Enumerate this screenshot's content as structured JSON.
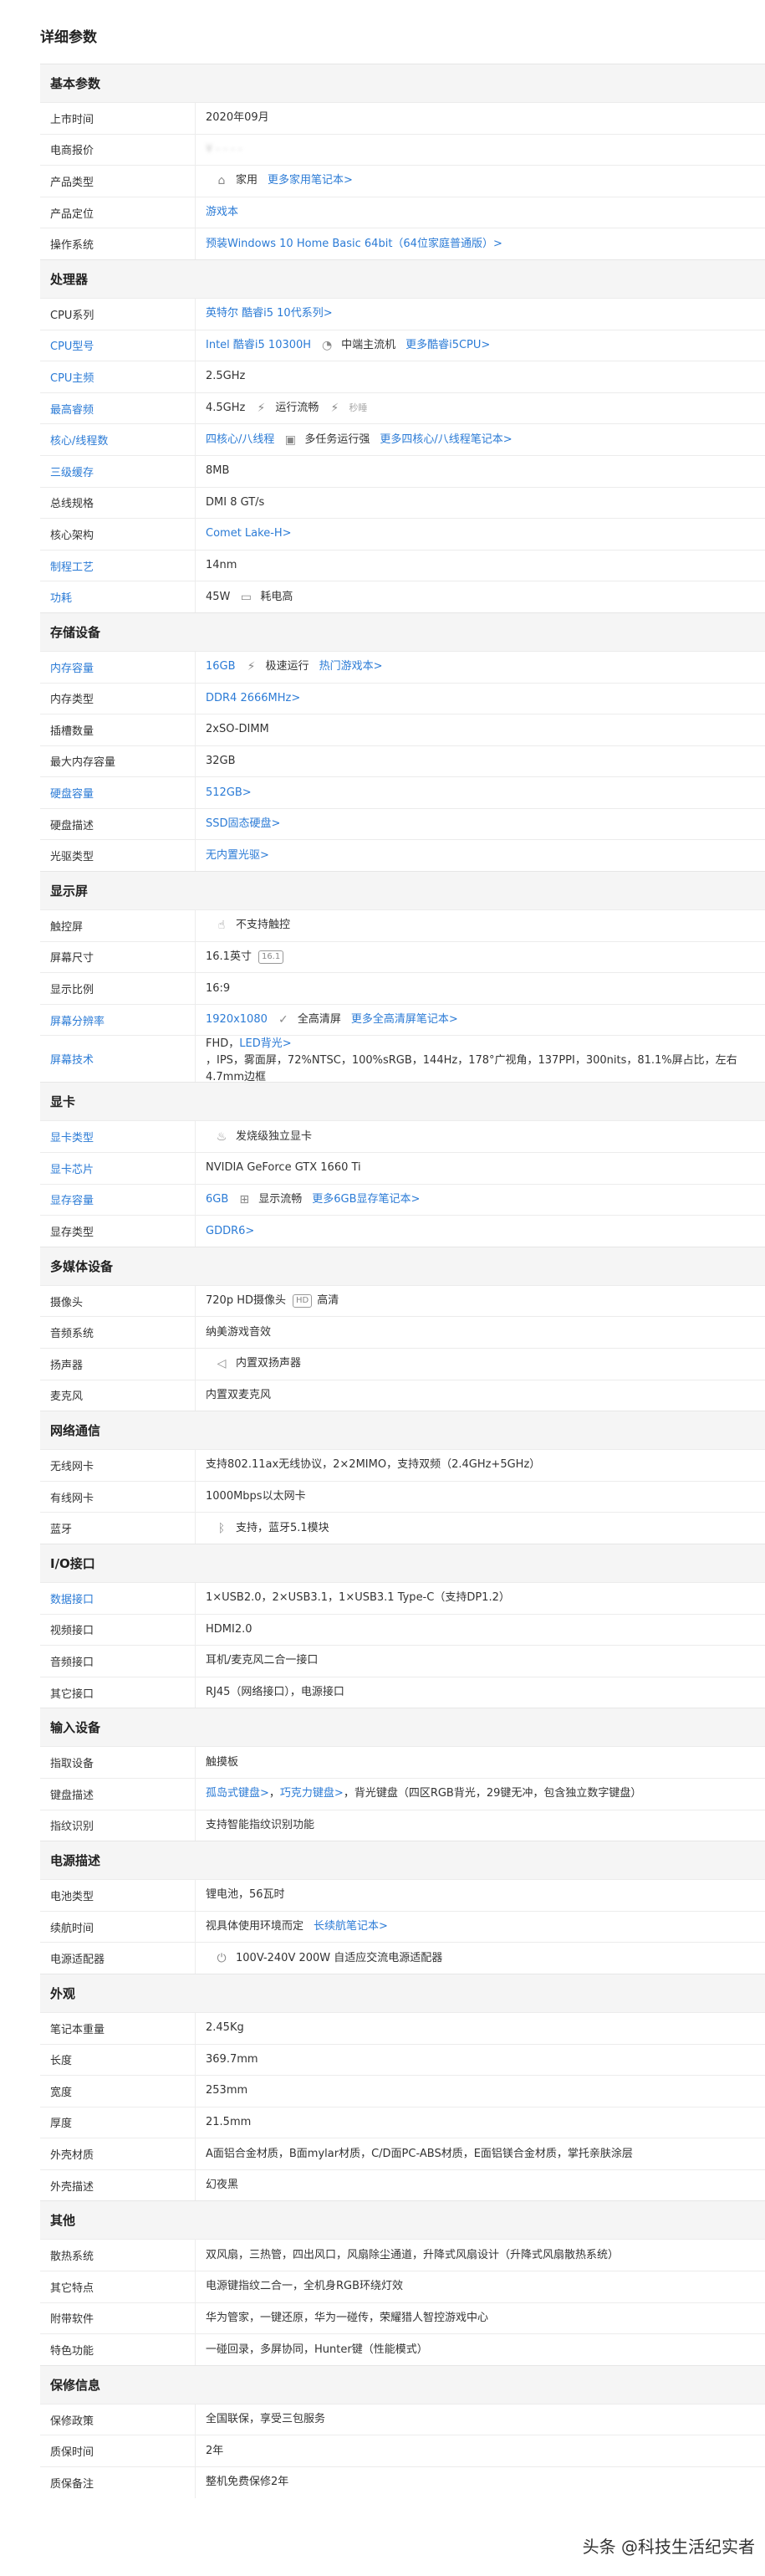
{
  "page_title": "详细参数",
  "watermark": "头条 @科技生活纪实者",
  "sections": [
    {
      "title": "基本参数",
      "rows": [
        {
          "k": "上市时间",
          "v": [
            {
              "t": "2020年09月"
            }
          ]
        },
        {
          "k": "电商报价",
          "v": [
            {
              "t": "¥ - - - -",
              "blur": true
            }
          ]
        },
        {
          "k": "产品类型",
          "v": [
            {
              "icon": "home-icon",
              "glyph": "⌂"
            },
            {
              "t": "家用"
            },
            {
              "t": "更多家用笔记本>",
              "link": true
            }
          ]
        },
        {
          "k": "产品定位",
          "v": [
            {
              "t": "游戏本",
              "link": true
            }
          ]
        },
        {
          "k": "操作系统",
          "v": [
            {
              "t": "预装Windows 10 Home Basic 64bit（64位家庭普通版）>",
              "link": true
            }
          ]
        }
      ]
    },
    {
      "title": "处理器",
      "rows": [
        {
          "k": "CPU系列",
          "v": [
            {
              "t": "英特尔 酷睿i5 10代系列>",
              "link": true
            }
          ]
        },
        {
          "k": "CPU型号",
          "blue": true,
          "v": [
            {
              "t": "Intel 酷睿i5 10300H",
              "link": true
            },
            {
              "icon": "speedometer-icon",
              "glyph": "◔"
            },
            {
              "t": "中端主流机"
            },
            {
              "t": "更多酷睿i5CPU>",
              "link": true
            }
          ]
        },
        {
          "k": "CPU主频",
          "blue": true,
          "v": [
            {
              "t": "2.5GHz"
            }
          ]
        },
        {
          "k": "最高睿频",
          "blue": true,
          "v": [
            {
              "t": "4.5GHz"
            },
            {
              "icon": "lightning-icon",
              "glyph": "⚡"
            },
            {
              "t": "运行流畅"
            },
            {
              "icon": "lightning-icon",
              "glyph": "⚡"
            },
            {
              "t": "秒睡",
              "muted": true
            }
          ]
        },
        {
          "k": "核心/线程数",
          "blue": true,
          "v": [
            {
              "t": "四核心/八线程",
              "link": true
            },
            {
              "icon": "multitask-icon",
              "glyph": "▣"
            },
            {
              "t": "多任务运行强"
            },
            {
              "t": "更多四核心/八线程笔记本>",
              "link": true
            }
          ]
        },
        {
          "k": "三级缓存",
          "blue": true,
          "v": [
            {
              "t": "8MB"
            }
          ]
        },
        {
          "k": "总线规格",
          "v": [
            {
              "t": "DMI 8 GT/s"
            }
          ]
        },
        {
          "k": "核心架构",
          "v": [
            {
              "t": "Comet Lake-H>",
              "link": true
            }
          ]
        },
        {
          "k": "制程工艺",
          "blue": true,
          "v": [
            {
              "t": "14nm"
            }
          ]
        },
        {
          "k": "功耗",
          "blue": true,
          "v": [
            {
              "t": "45W"
            },
            {
              "icon": "battery-icon",
              "glyph": "▭"
            },
            {
              "t": "耗电高"
            }
          ]
        }
      ]
    },
    {
      "title": "存储设备",
      "rows": [
        {
          "k": "内存容量",
          "blue": true,
          "v": [
            {
              "t": "16GB",
              "link": true
            },
            {
              "icon": "lightning-icon",
              "glyph": "⚡"
            },
            {
              "t": "极速运行"
            },
            {
              "t": "热门游戏本>",
              "link": true
            }
          ]
        },
        {
          "k": "内存类型",
          "v": [
            {
              "t": "DDR4 2666MHz>",
              "link": true
            }
          ]
        },
        {
          "k": "插槽数量",
          "v": [
            {
              "t": "2xSO-DIMM"
            }
          ]
        },
        {
          "k": "最大内存容量",
          "v": [
            {
              "t": "32GB"
            }
          ]
        },
        {
          "k": "硬盘容量",
          "blue": true,
          "v": [
            {
              "t": "512GB>",
              "link": true
            }
          ]
        },
        {
          "k": "硬盘描述",
          "v": [
            {
              "t": "SSD固态硬盘>",
              "link": true
            }
          ]
        },
        {
          "k": "光驱类型",
          "v": [
            {
              "t": "无内置光驱>",
              "link": true
            }
          ]
        }
      ]
    },
    {
      "title": "显示屏",
      "rows": [
        {
          "k": "触控屏",
          "v": [
            {
              "icon": "no-touch-icon",
              "glyph": "☝"
            },
            {
              "t": "不支持触控"
            }
          ]
        },
        {
          "k": "屏幕尺寸",
          "v": [
            {
              "t": "16.1英寸"
            },
            {
              "icon": "screen-size-icon",
              "box": "16.1"
            }
          ]
        },
        {
          "k": "显示比例",
          "v": [
            {
              "t": "16:9"
            }
          ]
        },
        {
          "k": "屏幕分辨率",
          "blue": true,
          "v": [
            {
              "t": "1920x1080",
              "link": true
            },
            {
              "icon": "check-icon",
              "glyph": "✓"
            },
            {
              "t": "全高清屏"
            },
            {
              "t": "更多全高清屏笔记本>",
              "link": true
            }
          ]
        },
        {
          "k": "屏幕技术",
          "blue": true,
          "tall": true,
          "v": [
            {
              "t": "FHD，"
            },
            {
              "t": "LED背光>",
              "link": true
            },
            {
              "t": "，IPS，雾面屏，72%NTSC，100%sRGB，144Hz，178°广视角，137PPI，300nits，81.1%屏占比，左右4.7mm边框"
            }
          ]
        }
      ]
    },
    {
      "title": "显卡",
      "rows": [
        {
          "k": "显卡类型",
          "blue": true,
          "v": [
            {
              "icon": "flame-icon",
              "glyph": "♨"
            },
            {
              "t": "发烧级独立显卡"
            }
          ]
        },
        {
          "k": "显卡芯片",
          "blue": true,
          "v": [
            {
              "t": "NVIDIA GeForce GTX 1660 Ti"
            }
          ]
        },
        {
          "k": "显存容量",
          "blue": true,
          "v": [
            {
              "t": "6GB",
              "link": true
            },
            {
              "icon": "gamepad-icon",
              "glyph": "⊞"
            },
            {
              "t": "显示流畅"
            },
            {
              "t": "更多6GB显存笔记本>",
              "link": true
            }
          ]
        },
        {
          "k": "显存类型",
          "v": [
            {
              "t": "GDDR6>",
              "link": true
            }
          ]
        }
      ]
    },
    {
      "title": "多媒体设备",
      "rows": [
        {
          "k": "摄像头",
          "v": [
            {
              "t": "720p HD摄像头"
            },
            {
              "icon": "hd-icon",
              "box": "HD"
            },
            {
              "t": "高清"
            }
          ]
        },
        {
          "k": "音频系统",
          "v": [
            {
              "t": "纳美游戏音效"
            }
          ]
        },
        {
          "k": "扬声器",
          "v": [
            {
              "icon": "speaker-icon",
              "glyph": "◁"
            },
            {
              "t": "内置双扬声器"
            }
          ]
        },
        {
          "k": "麦克风",
          "v": [
            {
              "t": "内置双麦克风"
            }
          ]
        }
      ]
    },
    {
      "title": "网络通信",
      "rows": [
        {
          "k": "无线网卡",
          "v": [
            {
              "t": "支持802.11ax无线协议，2×2MIMO，支持双频（2.4GHz+5GHz）"
            }
          ]
        },
        {
          "k": "有线网卡",
          "v": [
            {
              "t": "1000Mbps以太网卡"
            }
          ]
        },
        {
          "k": "蓝牙",
          "v": [
            {
              "icon": "bluetooth-icon",
              "glyph": "ᛒ"
            },
            {
              "t": "支持，蓝牙5.1模块"
            }
          ]
        }
      ]
    },
    {
      "title": "I/O接口",
      "rows": [
        {
          "k": "数据接口",
          "blue": true,
          "v": [
            {
              "t": "1×USB2.0，2×USB3.1，1×USB3.1 Type-C（支持DP1.2）"
            }
          ]
        },
        {
          "k": "视频接口",
          "v": [
            {
              "t": "HDMI2.0"
            }
          ]
        },
        {
          "k": "音频接口",
          "v": [
            {
              "t": "耳机/麦克风二合一接口"
            }
          ]
        },
        {
          "k": "其它接口",
          "v": [
            {
              "t": "RJ45（网络接口），电源接口"
            }
          ]
        }
      ]
    },
    {
      "title": "输入设备",
      "rows": [
        {
          "k": "指取设备",
          "v": [
            {
              "t": "触摸板"
            }
          ]
        },
        {
          "k": "键盘描述",
          "v": [
            {
              "t": "孤岛式键盘>",
              "link": true
            },
            {
              "t": "，"
            },
            {
              "t": "巧克力键盘>",
              "link": true
            },
            {
              "t": "，背光键盘（四区RGB背光，29键无冲，包含独立数字键盘）"
            }
          ]
        },
        {
          "k": "指纹识别",
          "v": [
            {
              "t": "支持智能指纹识别功能"
            }
          ]
        }
      ]
    },
    {
      "title": "电源描述",
      "rows": [
        {
          "k": "电池类型",
          "v": [
            {
              "t": "锂电池，56瓦时"
            }
          ]
        },
        {
          "k": "续航时间",
          "v": [
            {
              "t": "视具体使用环境而定"
            },
            {
              "t": "长续航笔记本>",
              "link": true
            }
          ]
        },
        {
          "k": "电源适配器",
          "v": [
            {
              "icon": "power-adapter-icon",
              "glyph": "⏻"
            },
            {
              "t": "100V-240V 200W 自适应交流电源适配器"
            }
          ]
        }
      ]
    },
    {
      "title": "外观",
      "rows": [
        {
          "k": "笔记本重量",
          "v": [
            {
              "t": "2.45Kg"
            }
          ]
        },
        {
          "k": "长度",
          "v": [
            {
              "t": "369.7mm"
            }
          ]
        },
        {
          "k": "宽度",
          "v": [
            {
              "t": "253mm"
            }
          ]
        },
        {
          "k": "厚度",
          "v": [
            {
              "t": "21.5mm"
            }
          ]
        },
        {
          "k": "外壳材质",
          "v": [
            {
              "t": "A面铝合金材质，B面mylar材质，C/D面PC-ABS材质，E面铝镁合金材质，掌托亲肤涂层"
            }
          ]
        },
        {
          "k": "外壳描述",
          "v": [
            {
              "t": "幻夜黑"
            }
          ]
        }
      ]
    },
    {
      "title": "其他",
      "rows": [
        {
          "k": "散热系统",
          "v": [
            {
              "t": "双风扇，三热管，四出风口，风扇除尘通道，升降式风扇设计（升降式风扇散热系统）"
            }
          ]
        },
        {
          "k": "其它特点",
          "v": [
            {
              "t": "电源键指纹二合一，全机身RGB环绕灯效"
            }
          ]
        },
        {
          "k": "附带软件",
          "v": [
            {
              "t": "华为管家，一键还原，华为一碰传，荣耀猎人智控游戏中心"
            }
          ]
        },
        {
          "k": "特色功能",
          "v": [
            {
              "t": "一碰回录，多屏协同，Hunter键（性能模式）"
            }
          ]
        }
      ]
    },
    {
      "title": "保修信息",
      "rows": [
        {
          "k": "保修政策",
          "v": [
            {
              "t": "全国联保，享受三包服务"
            }
          ]
        },
        {
          "k": "质保时间",
          "v": [
            {
              "t": "2年"
            }
          ]
        },
        {
          "k": "质保备注",
          "v": [
            {
              "t": "整机免费保修2年"
            }
          ]
        }
      ]
    }
  ]
}
